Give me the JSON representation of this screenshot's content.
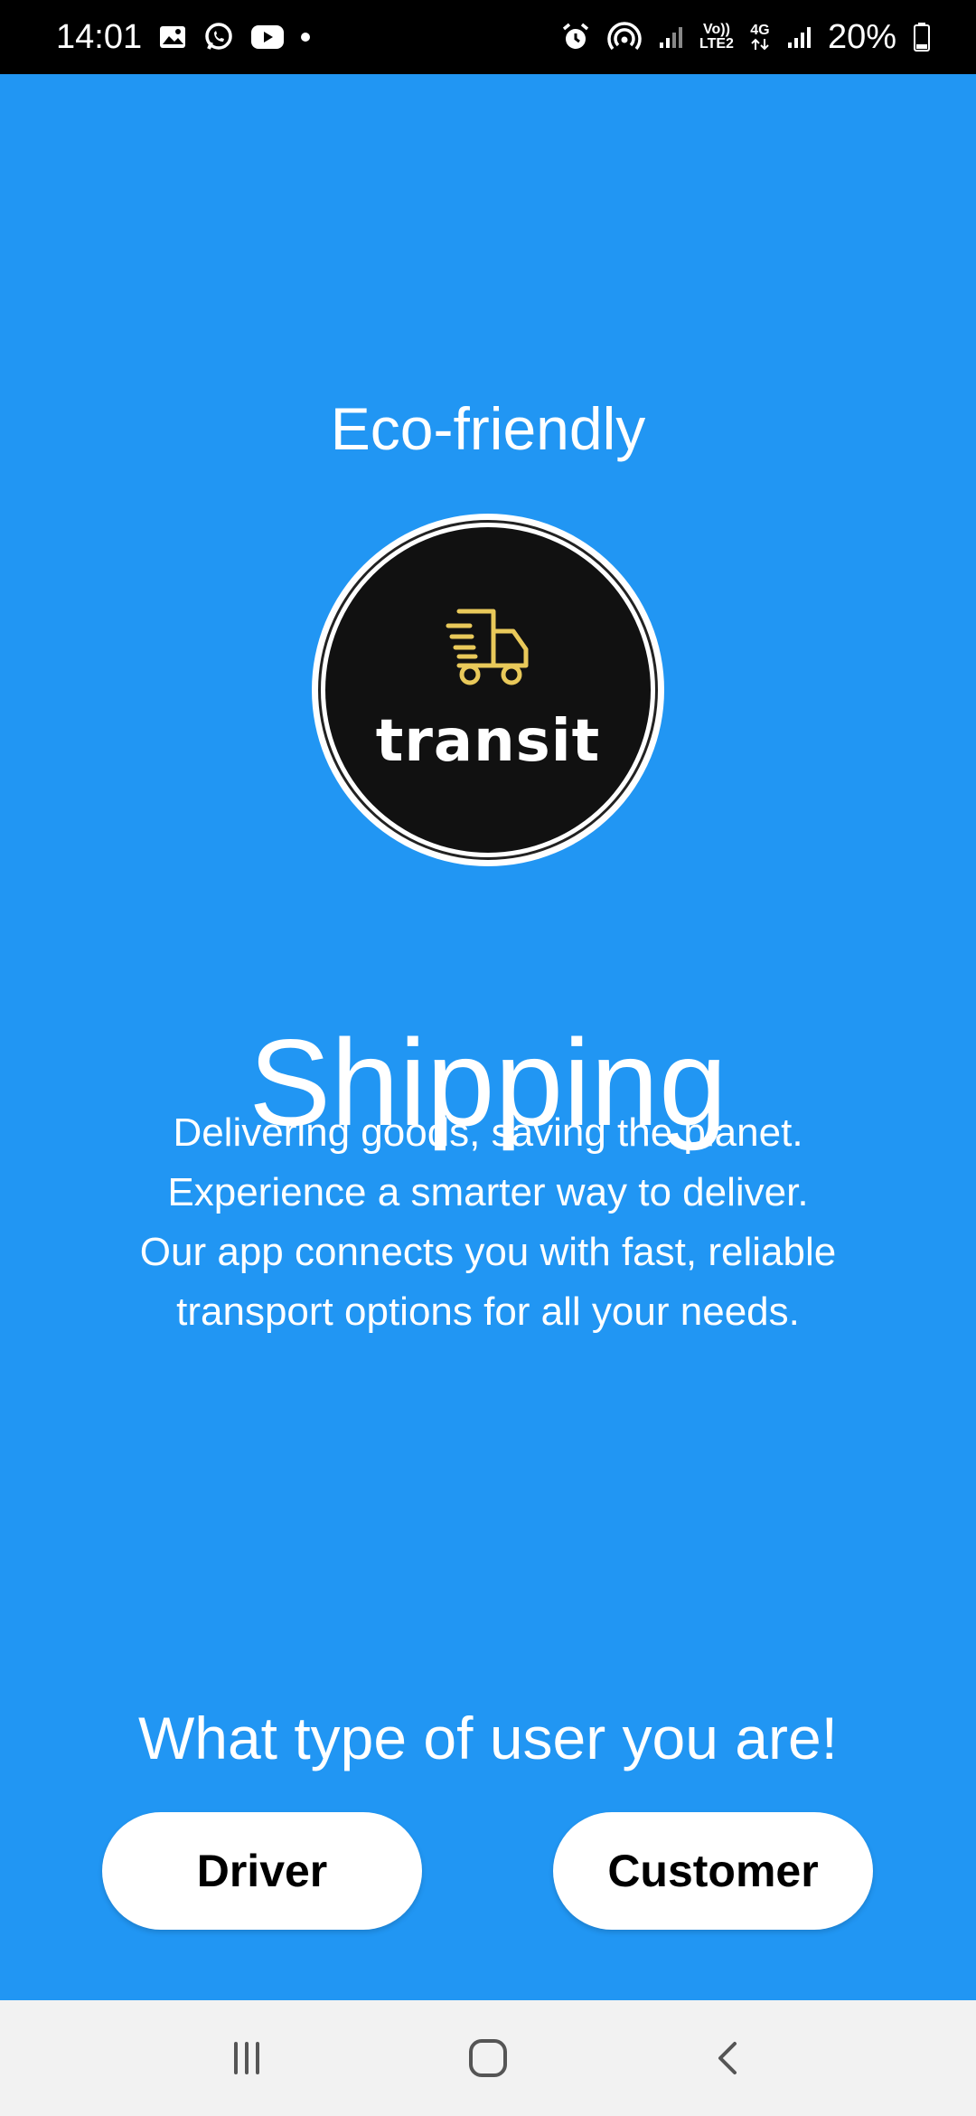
{
  "status_bar": {
    "time": "14:01",
    "network_volte": "Vo))",
    "network_lte": "LTE2",
    "network_4g": "4G",
    "battery": "20%"
  },
  "main": {
    "eco_title": "Eco-friendly",
    "logo_text": "transit",
    "shipping_title": "Shipping",
    "description_lines": [
      "Delivering goods, saving the planet.",
      "Experience a smarter way to deliver.",
      "Our app connects you with fast, reliable",
      "transport options for all your needs."
    ],
    "user_question": "What type of user you are!",
    "driver_button": "Driver",
    "customer_button": "Customer"
  },
  "icons": {
    "gallery": "image-icon",
    "whatsapp": "whatsapp-icon",
    "youtube": "youtube-icon",
    "alarm": "alarm-icon",
    "hotspot": "hotspot-icon",
    "truck": "truck-icon",
    "recents": "recents-icon",
    "home": "home-icon",
    "back": "back-icon"
  },
  "colors": {
    "background": "#2196f3",
    "logo_accent": "#e9c95a",
    "button_bg": "#ffffff"
  }
}
